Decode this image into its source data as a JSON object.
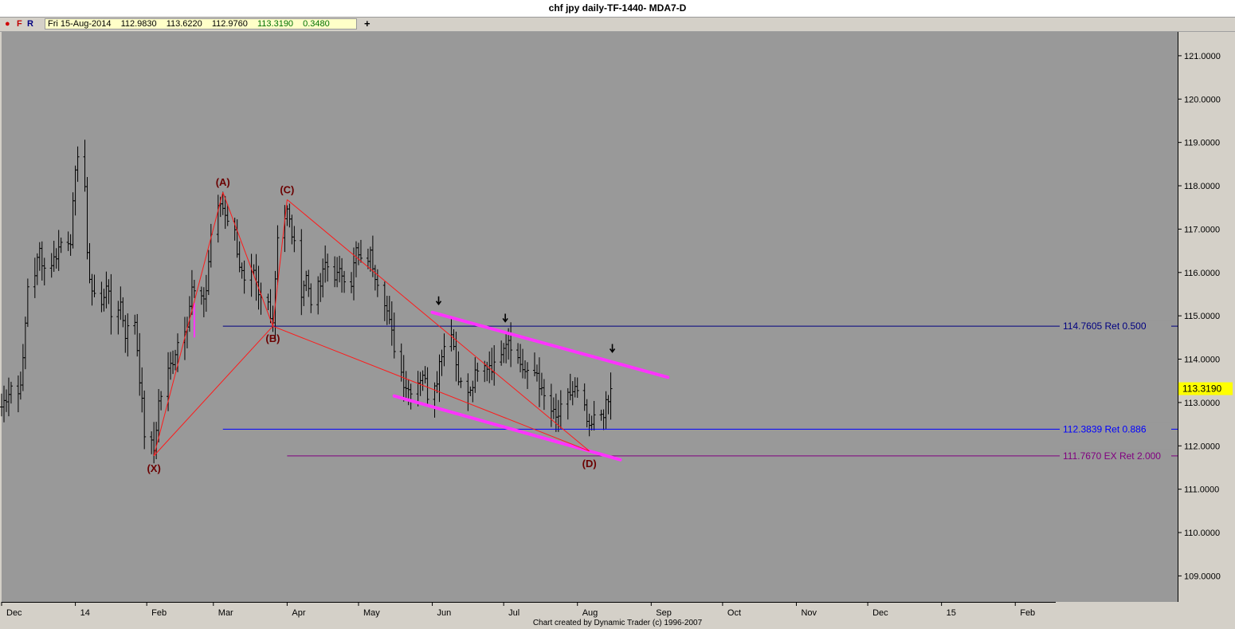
{
  "window": {
    "title": "chf jpy daily-TF-1440- MDA7-D"
  },
  "toolbar": {
    "dot_icon": "red-dot-icon",
    "f_label": "F",
    "r_label": "R",
    "ohlc": {
      "date": "Fri 15-Aug-2014",
      "open": "112.9830",
      "high": "113.6220",
      "low": "112.9760",
      "close": "113.3190",
      "change": "0.3480"
    },
    "crosshair_icon": "crosshair-plus-icon"
  },
  "footer": {
    "credit": "Chart created by Dynamic Trader  (c) 1996-2007"
  },
  "colors": {
    "plot_bg": "#999999",
    "bars": "#000000",
    "pattern": "#ff1a1a",
    "channel": "#ff33ff",
    "ret_050": "#000080",
    "ret_0886": "#0000ff",
    "ext_200": "#800080",
    "label": "#6b0000",
    "last_price_bg": "#ffff00"
  },
  "chart_data": {
    "type": "ohlc",
    "instrument": "chf jpy daily",
    "y_ticks": [
      "109.0000",
      "110.0000",
      "111.0000",
      "112.0000",
      "113.0000",
      "114.0000",
      "115.0000",
      "116.0000",
      "117.0000",
      "118.0000",
      "119.0000",
      "120.0000",
      "121.0000"
    ],
    "ylim": [
      108.4,
      121.55
    ],
    "x_labels": [
      "Dec",
      "14",
      "Feb",
      "Mar",
      "Apr",
      "May",
      "Jun",
      "Jul",
      "Aug",
      "Sep",
      "Oct",
      "Nov",
      "Dec",
      "15",
      "Feb"
    ],
    "x_range": [
      "2013-12-02",
      "2015-02-18"
    ],
    "last_price": "113.3190",
    "closes": [
      {
        "date": "2013-12-02",
        "c": 112.9
      },
      {
        "date": "2013-12-06",
        "c": 113.4
      },
      {
        "date": "2013-12-09",
        "c": 113.2
      },
      {
        "date": "2013-12-11",
        "c": 113.9
      },
      {
        "date": "2013-12-13",
        "c": 115.7
      },
      {
        "date": "2013-12-16",
        "c": 116.0
      },
      {
        "date": "2013-12-18",
        "c": 116.5
      },
      {
        "date": "2013-12-20",
        "c": 116.1
      },
      {
        "date": "2013-12-24",
        "c": 116.3
      },
      {
        "date": "2013-12-27",
        "c": 116.7
      },
      {
        "date": "2013-12-31",
        "c": 116.8
      },
      {
        "date": "2014-01-02",
        "c": 118.2
      },
      {
        "date": "2014-01-03",
        "c": 118.8
      },
      {
        "date": "2014-01-06",
        "c": 118.0
      },
      {
        "date": "2014-01-07",
        "c": 116.3
      },
      {
        "date": "2014-01-09",
        "c": 115.6
      },
      {
        "date": "2014-01-13",
        "c": 115.2
      },
      {
        "date": "2014-01-15",
        "c": 115.8
      },
      {
        "date": "2014-01-17",
        "c": 115.0
      },
      {
        "date": "2014-01-21",
        "c": 115.3
      },
      {
        "date": "2014-01-23",
        "c": 114.6
      },
      {
        "date": "2014-01-27",
        "c": 114.9
      },
      {
        "date": "2014-01-29",
        "c": 113.6
      },
      {
        "date": "2014-01-31",
        "c": 112.3
      },
      {
        "date": "2014-02-04",
        "c": 111.9
      },
      {
        "date": "2014-02-06",
        "c": 113.0
      },
      {
        "date": "2014-02-10",
        "c": 113.7
      },
      {
        "date": "2014-02-12",
        "c": 114.0
      },
      {
        "date": "2014-02-14",
        "c": 114.4
      },
      {
        "date": "2014-02-18",
        "c": 114.9
      },
      {
        "date": "2014-02-20",
        "c": 115.6
      },
      {
        "date": "2014-02-24",
        "c": 115.3
      },
      {
        "date": "2014-02-26",
        "c": 115.6
      },
      {
        "date": "2014-02-28",
        "c": 116.9
      },
      {
        "date": "2014-03-04",
        "c": 117.6
      },
      {
        "date": "2014-03-06",
        "c": 117.4
      },
      {
        "date": "2014-03-10",
        "c": 116.9
      },
      {
        "date": "2014-03-12",
        "c": 116.2
      },
      {
        "date": "2014-03-14",
        "c": 115.7
      },
      {
        "date": "2014-03-18",
        "c": 115.9
      },
      {
        "date": "2014-03-20",
        "c": 115.4
      },
      {
        "date": "2014-03-24",
        "c": 115.3
      },
      {
        "date": "2014-03-26",
        "c": 114.9
      },
      {
        "date": "2014-03-28",
        "c": 116.9
      },
      {
        "date": "2014-04-01",
        "c": 117.4
      },
      {
        "date": "2014-04-03",
        "c": 116.9
      },
      {
        "date": "2014-04-07",
        "c": 115.6
      },
      {
        "date": "2014-04-09",
        "c": 115.9
      },
      {
        "date": "2014-04-11",
        "c": 115.4
      },
      {
        "date": "2014-04-15",
        "c": 115.7
      },
      {
        "date": "2014-04-17",
        "c": 116.2
      },
      {
        "date": "2014-04-22",
        "c": 115.9
      },
      {
        "date": "2014-04-24",
        "c": 116.0
      },
      {
        "date": "2014-04-28",
        "c": 115.8
      },
      {
        "date": "2014-04-30",
        "c": 116.5
      },
      {
        "date": "2014-05-02",
        "c": 116.2
      },
      {
        "date": "2014-05-06",
        "c": 116.4
      },
      {
        "date": "2014-05-08",
        "c": 116.0
      },
      {
        "date": "2014-05-12",
        "c": 115.4
      },
      {
        "date": "2014-05-14",
        "c": 114.8
      },
      {
        "date": "2014-05-16",
        "c": 114.3
      },
      {
        "date": "2014-05-20",
        "c": 113.5
      },
      {
        "date": "2014-05-22",
        "c": 113.3
      },
      {
        "date": "2014-05-26",
        "c": 113.5
      },
      {
        "date": "2014-05-28",
        "c": 113.7
      },
      {
        "date": "2014-05-30",
        "c": 113.2
      },
      {
        "date": "2014-06-03",
        "c": 113.6
      },
      {
        "date": "2014-06-05",
        "c": 114.2
      },
      {
        "date": "2014-06-09",
        "c": 114.7
      },
      {
        "date": "2014-06-11",
        "c": 113.9
      },
      {
        "date": "2014-06-13",
        "c": 113.4
      },
      {
        "date": "2014-06-17",
        "c": 113.2
      },
      {
        "date": "2014-06-19",
        "c": 113.6
      },
      {
        "date": "2014-06-23",
        "c": 113.8
      },
      {
        "date": "2014-06-25",
        "c": 113.9
      },
      {
        "date": "2014-06-27",
        "c": 113.8
      },
      {
        "date": "2014-07-01",
        "c": 114.4
      },
      {
        "date": "2014-07-03",
        "c": 114.5
      },
      {
        "date": "2014-07-07",
        "c": 114.0
      },
      {
        "date": "2014-07-09",
        "c": 113.8
      },
      {
        "date": "2014-07-11",
        "c": 113.6
      },
      {
        "date": "2014-07-15",
        "c": 113.7
      },
      {
        "date": "2014-07-17",
        "c": 113.2
      },
      {
        "date": "2014-07-21",
        "c": 112.8
      },
      {
        "date": "2014-07-23",
        "c": 112.6
      },
      {
        "date": "2014-07-25",
        "c": 112.8
      },
      {
        "date": "2014-07-29",
        "c": 113.2
      },
      {
        "date": "2014-07-31",
        "c": 113.3
      },
      {
        "date": "2014-08-04",
        "c": 112.8
      },
      {
        "date": "2014-08-06",
        "c": 112.3
      },
      {
        "date": "2014-08-08",
        "c": 112.6
      },
      {
        "date": "2014-08-12",
        "c": 112.8
      },
      {
        "date": "2014-08-14",
        "c": 113.0
      },
      {
        "date": "2014-08-15",
        "c": 113.319
      }
    ],
    "pattern": {
      "points": [
        {
          "label": "(X)",
          "date": "2014-02-04",
          "price": 111.77
        },
        {
          "label": "(A)",
          "date": "2014-03-05",
          "price": 117.85
        },
        {
          "label": "(B)",
          "date": "2014-03-26",
          "price": 114.76
        },
        {
          "label": "(C)",
          "date": "2014-04-01",
          "price": 117.68
        },
        {
          "label": "(D)",
          "date": "2014-08-06",
          "price": 111.88
        }
      ],
      "legs": [
        [
          "(X)",
          "(A)"
        ],
        [
          "(A)",
          "(B)"
        ],
        [
          "(B)",
          "(C)"
        ],
        [
          "(C)",
          "(D)"
        ],
        [
          "(X)",
          "(B)"
        ],
        [
          "(B)",
          "(D)"
        ]
      ]
    },
    "levels": [
      {
        "price": 114.7605,
        "label": "114.7605 Ret 0.500",
        "from": "2014-03-05",
        "color": "#000080"
      },
      {
        "price": 112.3839,
        "label": "112.3839 Ret 0.886",
        "from": "2014-03-05",
        "color": "#0000ff"
      },
      {
        "price": 111.767,
        "label": "111.7670 EX Ret 2.000",
        "from": "2014-04-01",
        "color": "#800080"
      }
    ],
    "channel": [
      {
        "from": {
          "date": "2014-06-01",
          "price": 115.08
        },
        "to": {
          "date": "2014-09-08",
          "price": 113.58
        }
      },
      {
        "from": {
          "date": "2014-05-16",
          "price": 113.15
        },
        "to": {
          "date": "2014-08-19",
          "price": 111.68
        }
      }
    ],
    "markers": [
      {
        "date": "2014-06-03",
        "price": 115.1,
        "icon": "down-arrow-icon"
      },
      {
        "date": "2014-07-01",
        "price": 114.7,
        "icon": "down-arrow-icon"
      },
      {
        "date": "2014-08-15",
        "price": 114.0,
        "icon": "down-arrow-icon"
      }
    ],
    "extra_marks": [
      {
        "date": "2014-02-21",
        "low": 114.5,
        "high": 115.3,
        "color": "#ff33ff"
      }
    ]
  }
}
